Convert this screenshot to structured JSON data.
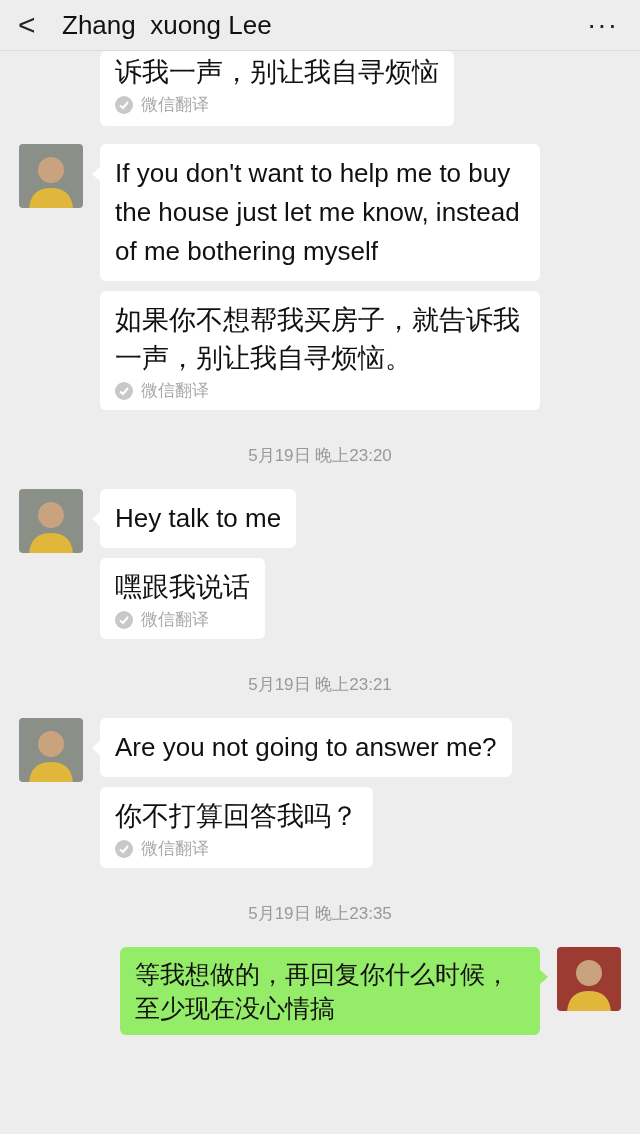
{
  "header": {
    "back": "<",
    "title": "Zhang  xuong Lee",
    "more": "···"
  },
  "messages": [
    {
      "kind": "translation",
      "text": "诉我一声，别让我自寻烦恼",
      "label": "微信翻译"
    },
    {
      "kind": "received",
      "text": "If you don't want to help me to buy the house just let me know, instead of me bothering myself",
      "translation": {
        "text": "如果你不想帮我买房子，就告诉我一声，别让我自寻烦恼。",
        "label": "微信翻译"
      }
    },
    {
      "kind": "time",
      "text": "5月19日 晚上23:20"
    },
    {
      "kind": "received",
      "text": "Hey talk to me",
      "translation": {
        "text": "嘿跟我说话",
        "label": "微信翻译"
      }
    },
    {
      "kind": "time",
      "text": "5月19日 晚上23:21"
    },
    {
      "kind": "received",
      "text": "Are you not going to answer me?",
      "translation": {
        "text": "你不打算回答我吗？",
        "label": "微信翻译"
      }
    },
    {
      "kind": "time",
      "text": "5月19日 晚上23:35"
    },
    {
      "kind": "sent",
      "text": "等我想做的，再回复你什么时候，至少现在没心情搞"
    }
  ]
}
